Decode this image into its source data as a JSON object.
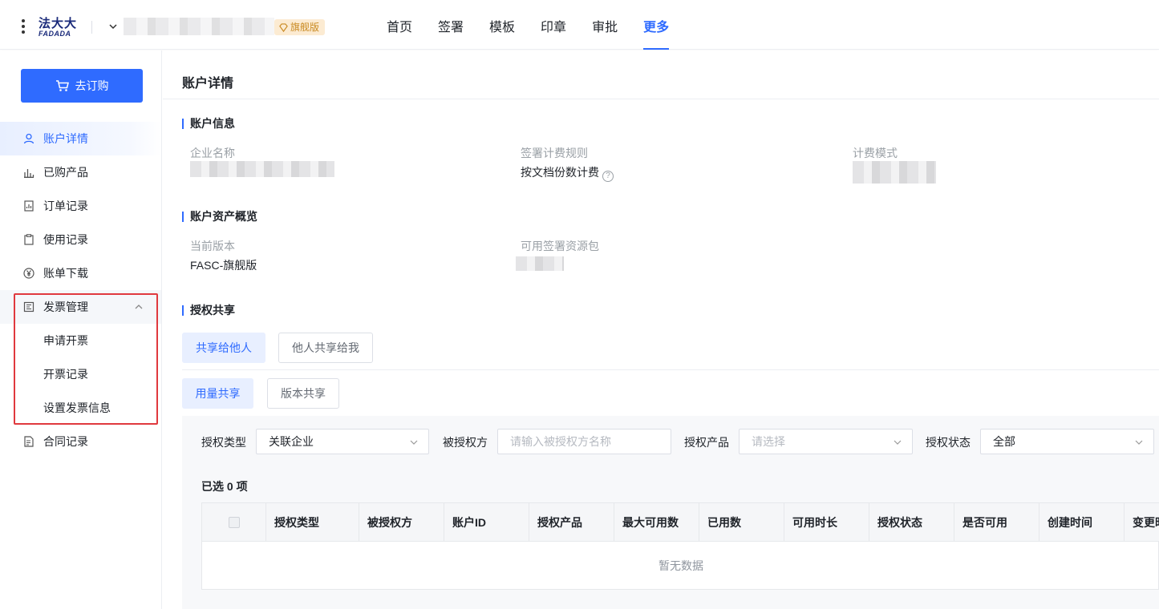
{
  "header": {
    "logo_cn": "法大大",
    "logo_en": "FADADA",
    "edition_badge": "旗舰版",
    "nav": [
      "首页",
      "签署",
      "模板",
      "印章",
      "审批",
      "更多"
    ],
    "active_nav": "更多"
  },
  "sidebar": {
    "buy_button": "去订购",
    "items": [
      {
        "label": "账户详情",
        "icon": "user-icon"
      },
      {
        "label": "已购产品",
        "icon": "bar-chart-icon"
      },
      {
        "label": "订单记录",
        "icon": "report-icon"
      },
      {
        "label": "使用记录",
        "icon": "clipboard-icon"
      },
      {
        "label": "账单下载",
        "icon": "yen-icon"
      },
      {
        "label": "发票管理",
        "icon": "invoice-icon"
      },
      {
        "label": "申请开票"
      },
      {
        "label": "开票记录"
      },
      {
        "label": "设置发票信息"
      },
      {
        "label": "合同记录",
        "icon": "document-icon"
      }
    ]
  },
  "main": {
    "page_title": "账户详情",
    "account_info": {
      "title": "账户信息",
      "company_label": "企业名称",
      "billing_rule_label": "签署计费规则",
      "billing_rule_value": "按文档份数计费",
      "billing_mode_label": "计费模式"
    },
    "assets": {
      "title": "账户资产概览",
      "version_label": "当前版本",
      "version_value": "FASC-旗舰版",
      "package_label": "可用签署资源包"
    },
    "sharing": {
      "title": "授权共享",
      "tabs": [
        "共享给他人",
        "他人共享给我"
      ],
      "subtabs": [
        "用量共享",
        "版本共享"
      ],
      "filters": {
        "type_label": "授权类型",
        "type_value": "关联企业",
        "grantee_label": "被授权方",
        "grantee_placeholder": "请输入被授权方名称",
        "product_label": "授权产品",
        "product_placeholder": "请选择",
        "status_label": "授权状态",
        "status_value": "全部"
      },
      "selected_count": "已选 0 项",
      "columns": [
        "授权类型",
        "被授权方",
        "账户ID",
        "授权产品",
        "最大可用数",
        "已用数",
        "可用时长",
        "授权状态",
        "是否可用",
        "创建时间",
        "变更时"
      ],
      "empty_text": "暂无数据"
    }
  },
  "colors": {
    "accent": "#2f6bff",
    "highlight_box": "#e0393e",
    "badge_bg": "#fcebd2",
    "badge_text": "#c98a22"
  }
}
